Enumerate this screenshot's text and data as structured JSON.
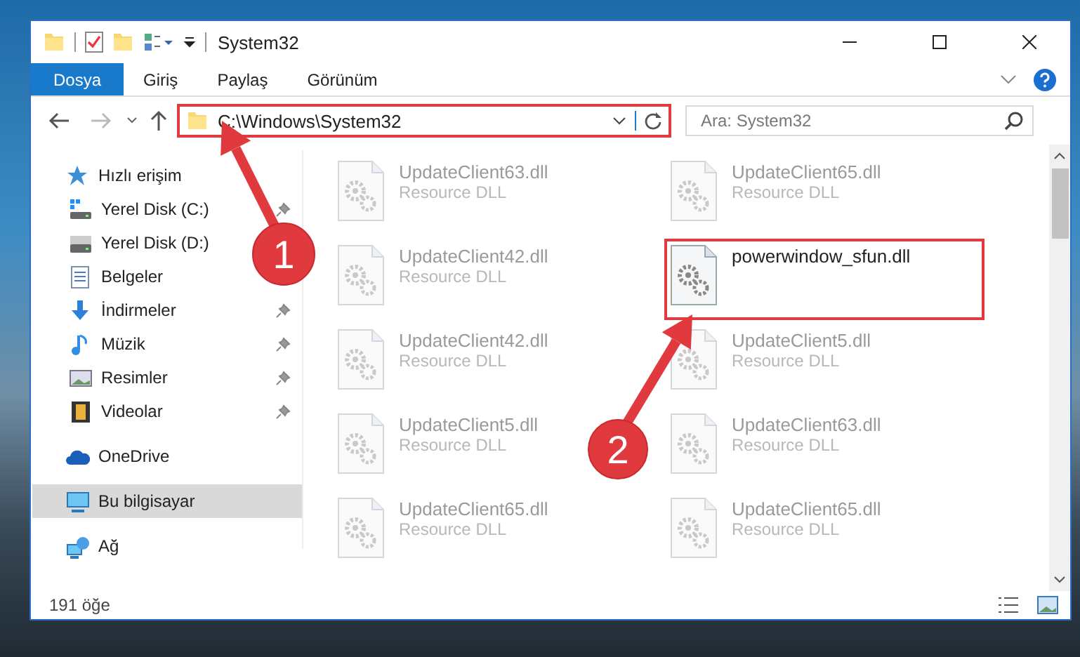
{
  "window": {
    "title": "System32"
  },
  "ribbon_tabs": [
    {
      "label": "Dosya",
      "selected": true
    },
    {
      "label": "Giriş",
      "selected": false
    },
    {
      "label": "Paylaş",
      "selected": false
    },
    {
      "label": "Görünüm",
      "selected": false
    }
  ],
  "address_bar": {
    "value": "C:\\Windows\\System32",
    "highlighted": true
  },
  "search": {
    "placeholder": "Ara: System32"
  },
  "navigation": [
    {
      "kind": "favorites",
      "label": "Hızlı erişim",
      "selected": false,
      "children": [
        {
          "kind": "systemdrive",
          "label": "Yerel Disk (C:)",
          "pinned": true,
          "selected": false
        },
        {
          "kind": "drive",
          "label": "Yerel Disk (D:)",
          "selected": false
        },
        {
          "kind": "documents",
          "label": "Belgeler",
          "selected": false
        },
        {
          "kind": "downloads",
          "label": "İndirmeler",
          "pinned": true,
          "selected": false
        },
        {
          "kind": "music",
          "label": "Müzik",
          "pinned": true,
          "selected": false
        },
        {
          "kind": "pictures",
          "label": "Resimler",
          "pinned": true,
          "selected": false
        },
        {
          "kind": "videos",
          "label": "Videolar",
          "pinned": true,
          "selected": false
        }
      ]
    },
    {
      "kind": "cloud",
      "label": "OneDrive",
      "selected": false
    },
    {
      "kind": "computer",
      "label": "Bu bilgisayar",
      "selected": true
    },
    {
      "kind": "network",
      "label": "Ağ",
      "selected": false
    }
  ],
  "files": [
    {
      "name": "UpdateClient63.dll",
      "type": "Resource DLL",
      "blurred": true,
      "highlighted": false
    },
    {
      "name": "UpdateClient65.dll",
      "type": "Resource DLL",
      "blurred": true,
      "highlighted": false
    },
    {
      "name": "UpdateClient42.dll",
      "type": "Resource DLL",
      "blurred": true,
      "highlighted": false
    },
    {
      "name": "powerwindow_sfun.dll",
      "blurred": false,
      "highlighted": true
    },
    {
      "name": "UpdateClient42.dll",
      "type": "Resource DLL",
      "blurred": true,
      "highlighted": false
    },
    {
      "name": "UpdateClient5.dll",
      "type": "Resource DLL",
      "blurred": true,
      "highlighted": false
    },
    {
      "name": "UpdateClient5.dll",
      "type": "Resource DLL",
      "blurred": true,
      "highlighted": false
    },
    {
      "name": "UpdateClient63.dll",
      "type": "Resource DLL",
      "blurred": true,
      "highlighted": false
    },
    {
      "name": "UpdateClient65.dll",
      "type": "Resource DLL",
      "blurred": true,
      "highlighted": false
    },
    {
      "name": "UpdateClient65.dll",
      "type": "Resource DLL",
      "blurred": true,
      "highlighted": false
    }
  ],
  "status_bar": {
    "item_count": "191 öğe"
  },
  "annotations": [
    {
      "number": "1"
    },
    {
      "number": "2"
    }
  ]
}
